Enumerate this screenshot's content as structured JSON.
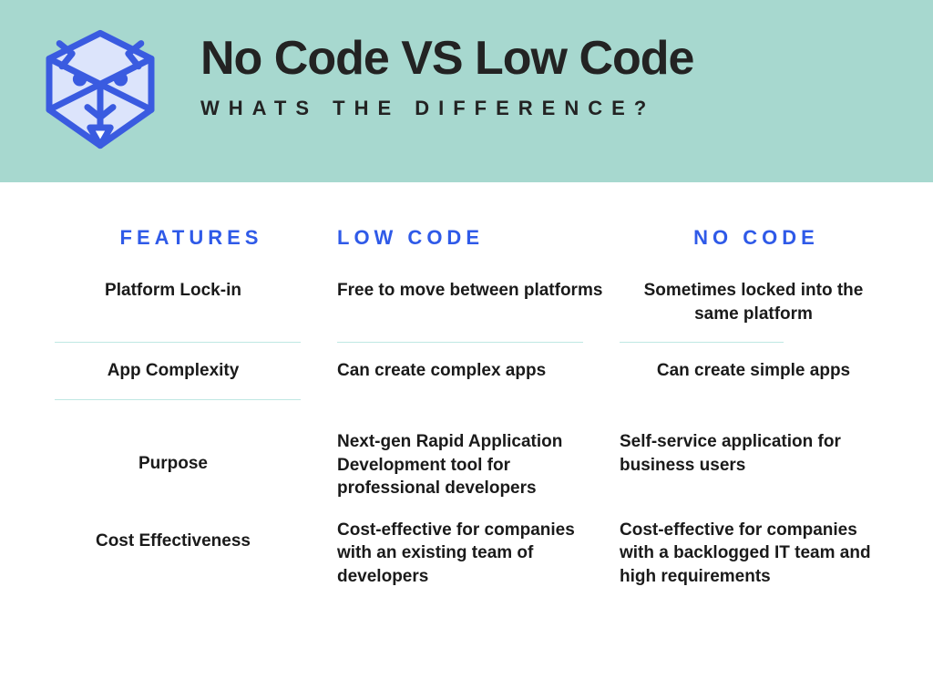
{
  "header": {
    "title": "No Code VS Low Code",
    "subtitle": "WHATS THE DIFFERENCE?"
  },
  "columns": {
    "features": "FEATURES",
    "lowcode": "LOW CODE",
    "nocode": "NO CODE"
  },
  "rows": [
    {
      "feature": "Platform Lock-in",
      "low": "Free to move between platforms",
      "no": "Sometimes locked into the same platform"
    },
    {
      "feature": "App Complexity",
      "low": "Can create complex apps",
      "no": "Can create simple apps"
    },
    {
      "feature": "Purpose",
      "low": "Next-gen Rapid Application Development tool for professional developers",
      "no": "Self-service application for business users"
    },
    {
      "feature": "Cost Effectiveness",
      "low": "Cost-effective for companies with an existing team of developers",
      "no": "Cost-effective for companies with a backlogged IT team and high requirements"
    }
  ]
}
